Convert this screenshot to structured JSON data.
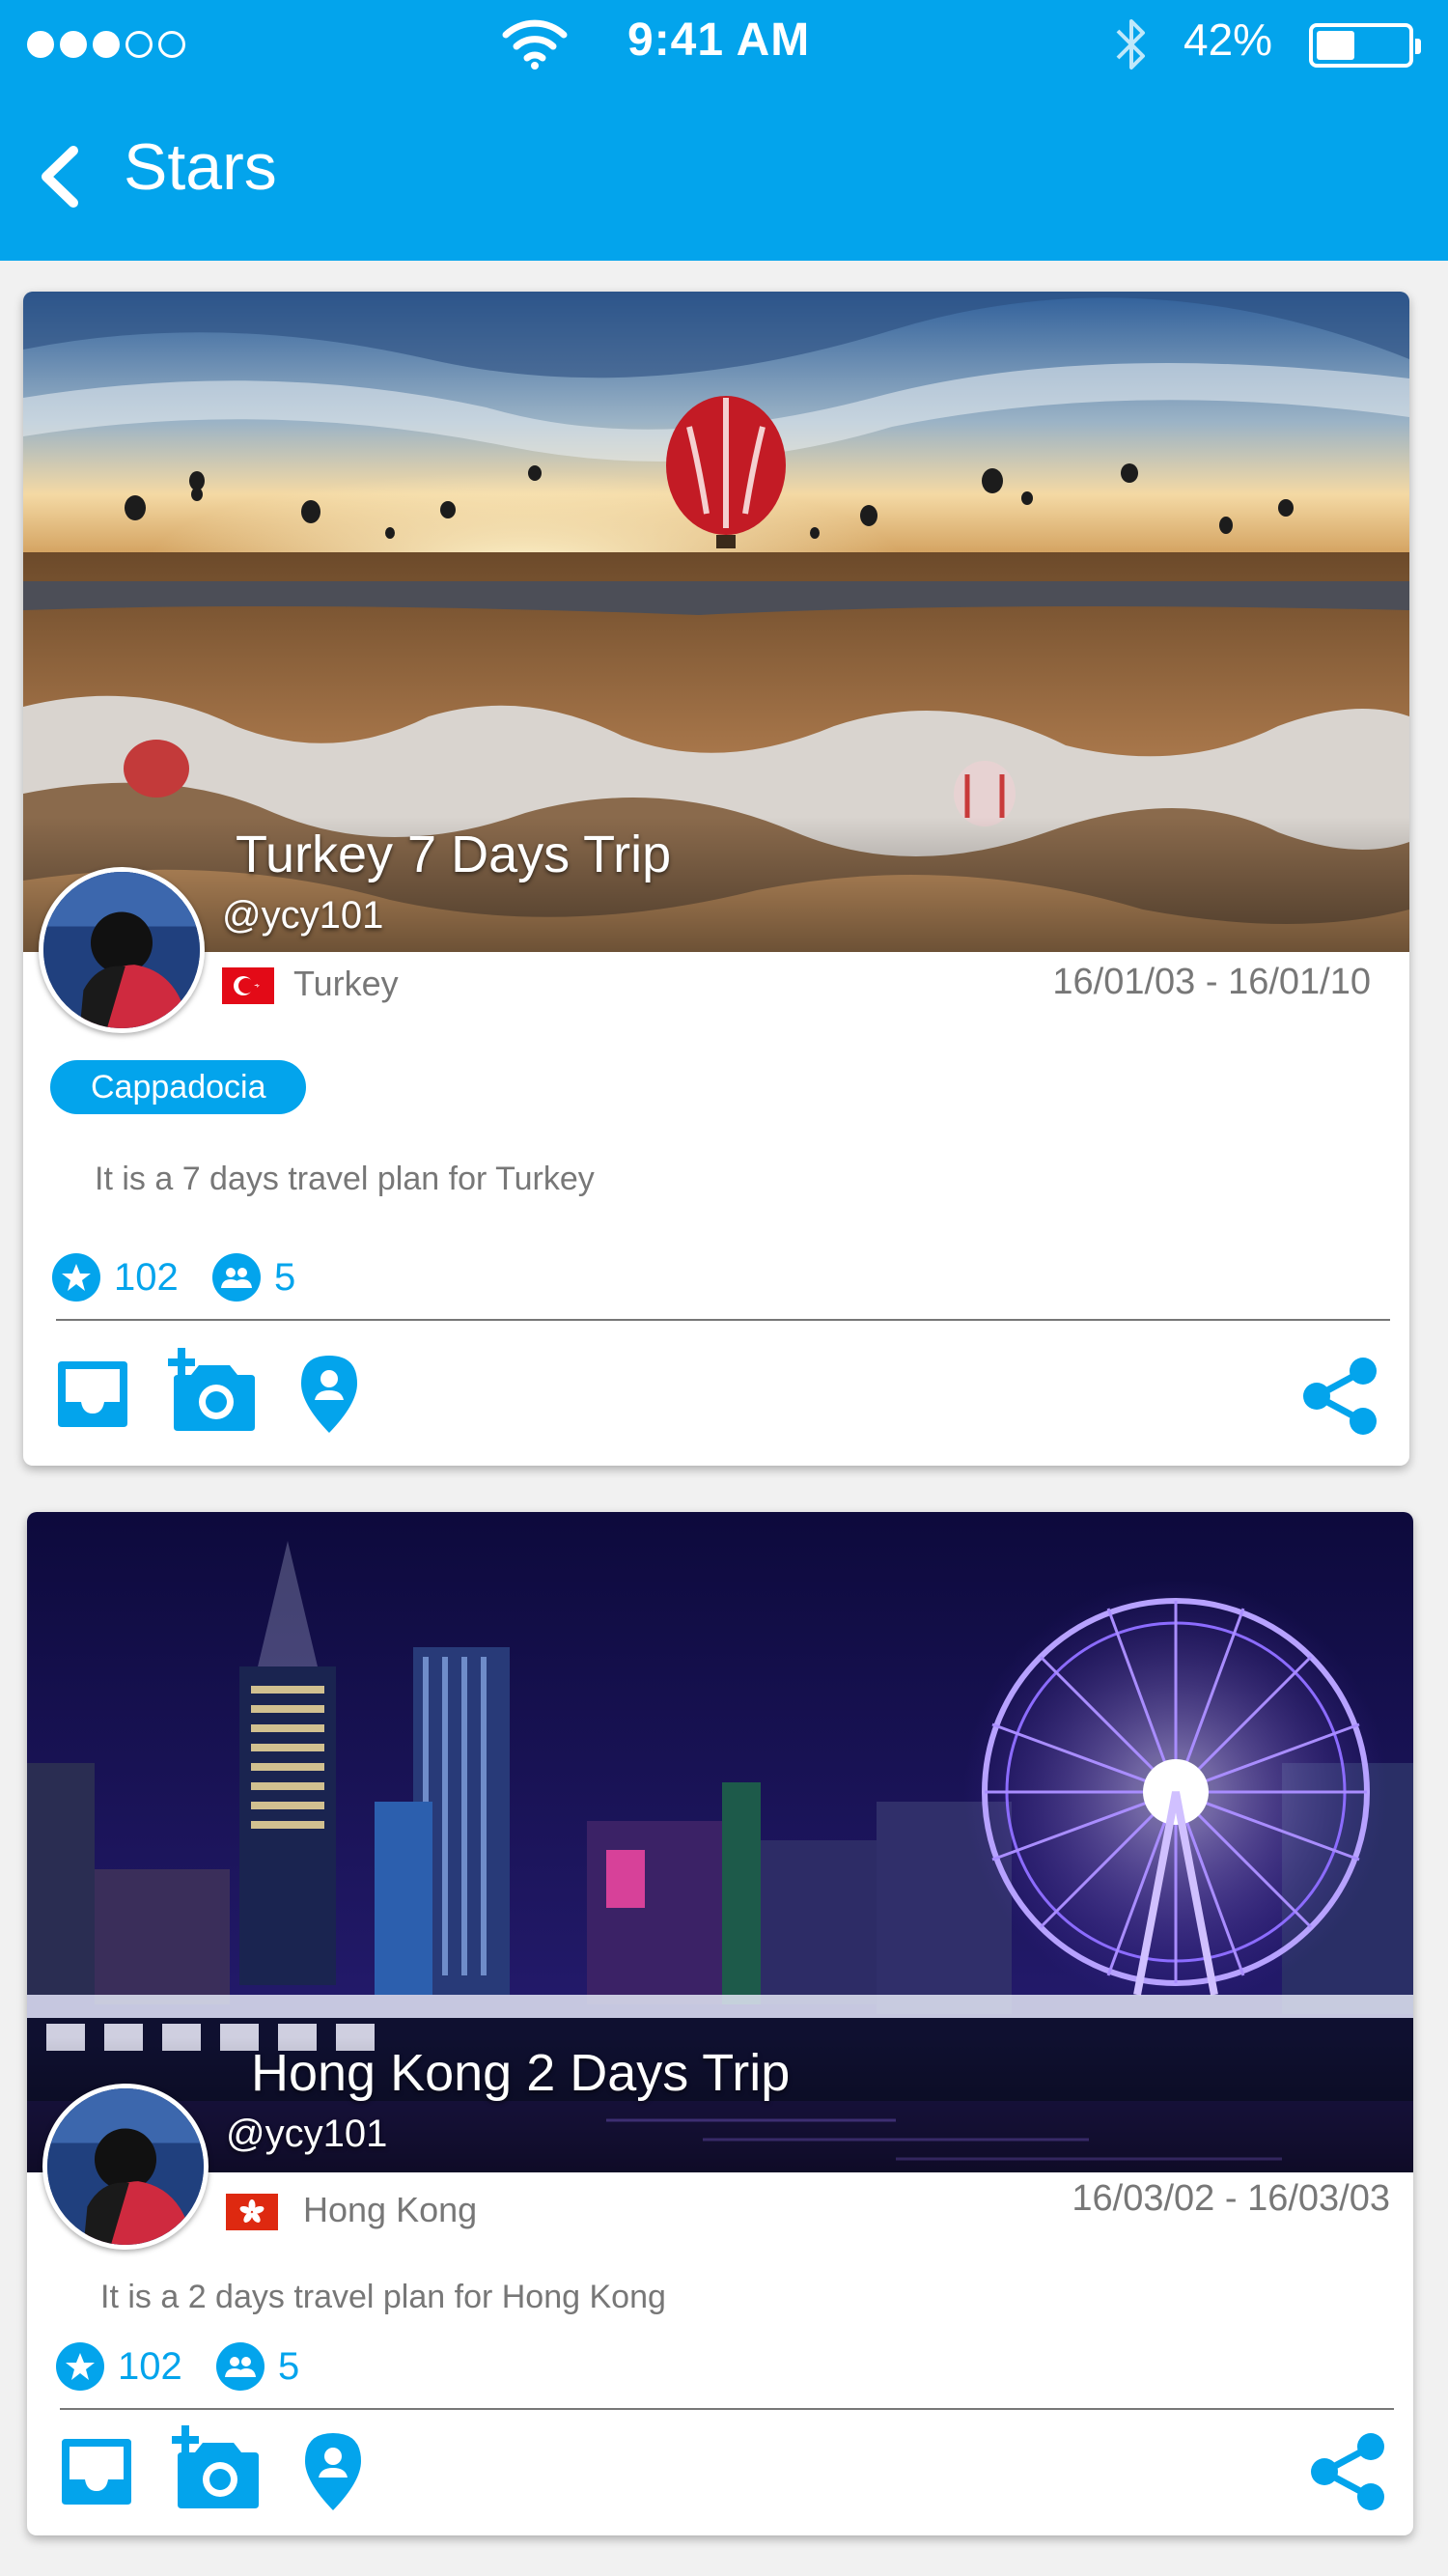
{
  "status_bar": {
    "signal_dots_filled": 3,
    "signal_dots_total": 5,
    "time": "9:41 AM",
    "battery_percent": "42%",
    "battery_level": 0.42
  },
  "header": {
    "title": "Stars",
    "back_icon": "chevron-left-icon"
  },
  "colors": {
    "accent": "#03a4ec",
    "muted_text": "#777777",
    "background": "#f1f1f1"
  },
  "trips": [
    {
      "title": "Turkey 7 Days Trip",
      "handle": "@ycy101",
      "country": "Turkey",
      "dates": "16/01/03 - 16/01/10",
      "tag": "Cappadocia",
      "description": "It is a 7 days travel plan for Turkey",
      "stars": "102",
      "members": "5",
      "actions": [
        "inbox-icon",
        "add-photo-icon",
        "location-pin-icon",
        "share-icon"
      ]
    },
    {
      "title": "Hong Kong 2 Days Trip",
      "handle": "@ycy101",
      "country": "Hong Kong",
      "dates": "16/03/02 - 16/03/03",
      "description": "It is a 2 days travel plan for Hong Kong",
      "stars": "102",
      "members": "5",
      "actions": [
        "inbox-icon",
        "add-photo-icon",
        "location-pin-icon",
        "share-icon"
      ]
    }
  ]
}
